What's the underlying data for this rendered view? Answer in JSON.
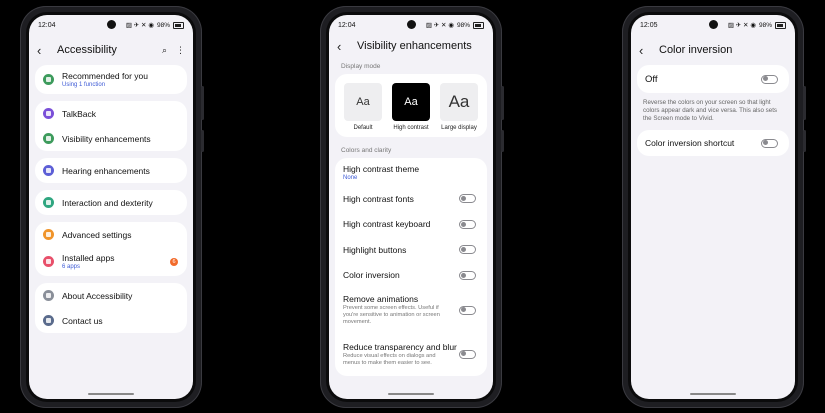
{
  "phone1": {
    "status": {
      "time": "12:04",
      "icons": "▨ ✈ ✕ ◉",
      "battery": "98%"
    },
    "title": "Accessibility",
    "groups": [
      [
        {
          "label": "Recommended for you",
          "sub": "Using 1 function",
          "icon": "star-icon",
          "color": "#3d9b5c"
        }
      ],
      [
        {
          "label": "TalkBack",
          "sub": "",
          "icon": "talkback-icon",
          "color": "#7a4fd8"
        },
        {
          "label": "Visibility enhancements",
          "sub": "",
          "icon": "eye-icon",
          "color": "#3d9b5c"
        }
      ],
      [
        {
          "label": "Hearing enhancements",
          "sub": "",
          "icon": "speaker-icon",
          "color": "#5d5fd6"
        }
      ],
      [
        {
          "label": "Interaction and dexterity",
          "sub": "",
          "icon": "hand-icon",
          "color": "#2fa680"
        }
      ],
      [
        {
          "label": "Advanced settings",
          "sub": "",
          "icon": "gear-plus-icon",
          "color": "#f0942a"
        },
        {
          "label": "Installed apps",
          "sub": "6 apps",
          "icon": "apps-icon",
          "color": "#e8506a",
          "badge": "6"
        }
      ],
      [
        {
          "label": "About Accessibility",
          "sub": "",
          "icon": "info-icon",
          "color": "#8a8f99"
        },
        {
          "label": "Contact us",
          "sub": "",
          "icon": "help-icon",
          "color": "#5a6b8c"
        }
      ]
    ]
  },
  "phone2": {
    "status": {
      "time": "12:04",
      "icons": "▨ ✈ ✕ ◉",
      "battery": "98%"
    },
    "title": "Visibility enhancements",
    "display_mode_header": "Display mode",
    "modes": [
      {
        "glyph": "Aa",
        "label": "Default",
        "style": "light"
      },
      {
        "glyph": "Aa",
        "label": "High contrast",
        "style": "dark"
      },
      {
        "glyph": "Aa",
        "label": "Large display",
        "style": "big"
      }
    ],
    "colors_header": "Colors and clarity",
    "theme": {
      "label": "High contrast theme",
      "value": "None"
    },
    "toggles": [
      {
        "label": "High contrast fonts",
        "desc": ""
      },
      {
        "label": "High contrast keyboard",
        "desc": ""
      },
      {
        "label": "Highlight buttons",
        "desc": ""
      },
      {
        "label": "Color inversion",
        "desc": ""
      },
      {
        "label": "Remove animations",
        "desc": "Prevent some screen effects. Useful if you're sensitive to animation or screen movement."
      },
      {
        "label": "Reduce transparency and blur",
        "desc": "Reduce visual effects on dialogs and menus to make them easier to see."
      }
    ]
  },
  "phone3": {
    "status": {
      "time": "12:05",
      "icons": "▨ ✈ ✕ ◉",
      "battery": "98%"
    },
    "title": "Color inversion",
    "off_label": "Off",
    "description": "Reverse the colors on your screen so that light colors appear dark and vice versa. This also sets the Screen mode to Vivid.",
    "shortcut_label": "Color inversion shortcut"
  }
}
